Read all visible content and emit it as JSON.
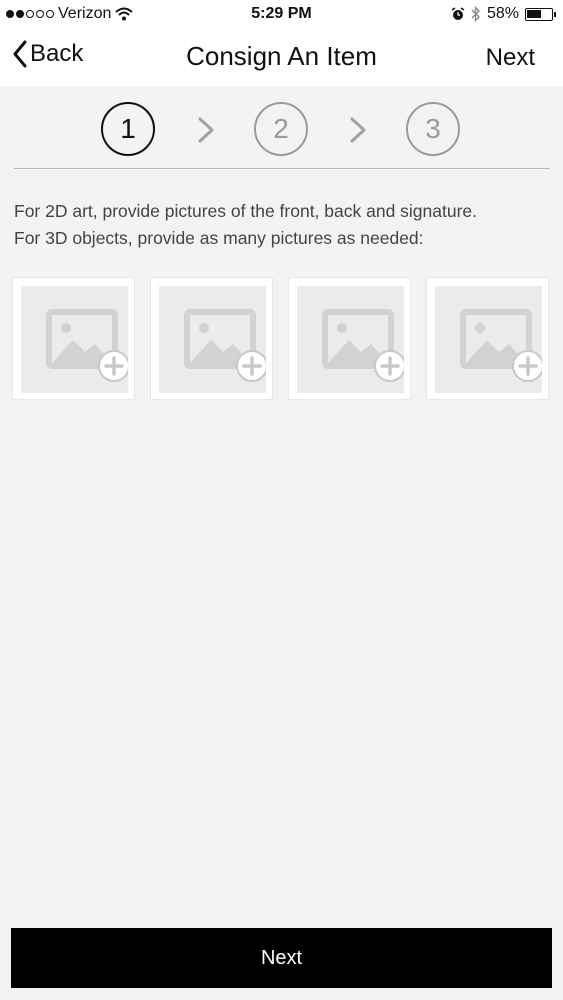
{
  "status_bar": {
    "carrier": "Verizon",
    "signal_bars_filled": 2,
    "signal_bars_total": 5,
    "time": "5:29 PM",
    "battery_percent": "58%",
    "battery_level": 0.58,
    "icons": [
      "wifi-icon",
      "alarm-icon",
      "bluetooth-icon",
      "battery-icon"
    ]
  },
  "nav": {
    "back_label": "Back",
    "title": "Consign An Item",
    "next_label": "Next"
  },
  "stepper": {
    "steps": [
      {
        "label": "1",
        "active": true
      },
      {
        "label": "2",
        "active": false
      },
      {
        "label": "3",
        "active": false
      }
    ]
  },
  "instructions": {
    "line1": "For 2D art, provide pictures of the front, back and signature.",
    "line2": "For 3D objects, provide as many pictures as needed:"
  },
  "photo_slots": [
    {
      "icon": "add-photo-icon"
    },
    {
      "icon": "add-photo-icon"
    },
    {
      "icon": "add-photo-icon"
    },
    {
      "icon": "add-photo-icon"
    }
  ],
  "bottom_button": {
    "label": "Next"
  },
  "colors": {
    "background": "#f4f3f1",
    "bar": "#ffffff",
    "button": "#000000",
    "inactive_step": "#9a9a9a"
  }
}
